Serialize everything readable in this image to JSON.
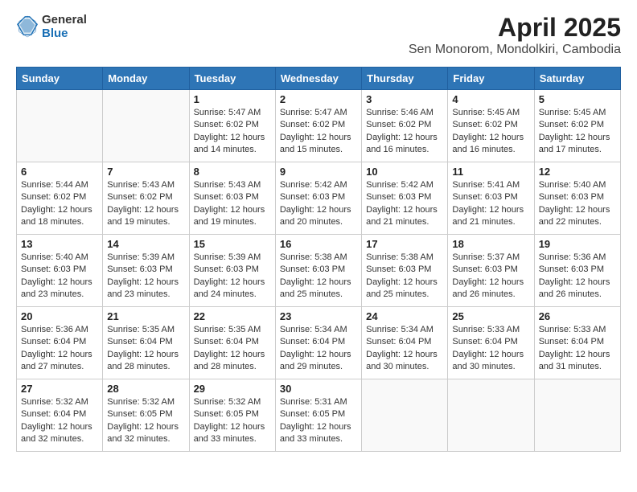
{
  "header": {
    "logo_general": "General",
    "logo_blue": "Blue",
    "month_title": "April 2025",
    "location": "Sen Monorom, Mondolkiri, Cambodia"
  },
  "days_of_week": [
    "Sunday",
    "Monday",
    "Tuesday",
    "Wednesday",
    "Thursday",
    "Friday",
    "Saturday"
  ],
  "weeks": [
    [
      {
        "day": "",
        "sunrise": "",
        "sunset": "",
        "daylight": ""
      },
      {
        "day": "",
        "sunrise": "",
        "sunset": "",
        "daylight": ""
      },
      {
        "day": "1",
        "sunrise": "Sunrise: 5:47 AM",
        "sunset": "Sunset: 6:02 PM",
        "daylight": "Daylight: 12 hours and 14 minutes."
      },
      {
        "day": "2",
        "sunrise": "Sunrise: 5:47 AM",
        "sunset": "Sunset: 6:02 PM",
        "daylight": "Daylight: 12 hours and 15 minutes."
      },
      {
        "day": "3",
        "sunrise": "Sunrise: 5:46 AM",
        "sunset": "Sunset: 6:02 PM",
        "daylight": "Daylight: 12 hours and 16 minutes."
      },
      {
        "day": "4",
        "sunrise": "Sunrise: 5:45 AM",
        "sunset": "Sunset: 6:02 PM",
        "daylight": "Daylight: 12 hours and 16 minutes."
      },
      {
        "day": "5",
        "sunrise": "Sunrise: 5:45 AM",
        "sunset": "Sunset: 6:02 PM",
        "daylight": "Daylight: 12 hours and 17 minutes."
      }
    ],
    [
      {
        "day": "6",
        "sunrise": "Sunrise: 5:44 AM",
        "sunset": "Sunset: 6:02 PM",
        "daylight": "Daylight: 12 hours and 18 minutes."
      },
      {
        "day": "7",
        "sunrise": "Sunrise: 5:43 AM",
        "sunset": "Sunset: 6:02 PM",
        "daylight": "Daylight: 12 hours and 19 minutes."
      },
      {
        "day": "8",
        "sunrise": "Sunrise: 5:43 AM",
        "sunset": "Sunset: 6:03 PM",
        "daylight": "Daylight: 12 hours and 19 minutes."
      },
      {
        "day": "9",
        "sunrise": "Sunrise: 5:42 AM",
        "sunset": "Sunset: 6:03 PM",
        "daylight": "Daylight: 12 hours and 20 minutes."
      },
      {
        "day": "10",
        "sunrise": "Sunrise: 5:42 AM",
        "sunset": "Sunset: 6:03 PM",
        "daylight": "Daylight: 12 hours and 21 minutes."
      },
      {
        "day": "11",
        "sunrise": "Sunrise: 5:41 AM",
        "sunset": "Sunset: 6:03 PM",
        "daylight": "Daylight: 12 hours and 21 minutes."
      },
      {
        "day": "12",
        "sunrise": "Sunrise: 5:40 AM",
        "sunset": "Sunset: 6:03 PM",
        "daylight": "Daylight: 12 hours and 22 minutes."
      }
    ],
    [
      {
        "day": "13",
        "sunrise": "Sunrise: 5:40 AM",
        "sunset": "Sunset: 6:03 PM",
        "daylight": "Daylight: 12 hours and 23 minutes."
      },
      {
        "day": "14",
        "sunrise": "Sunrise: 5:39 AM",
        "sunset": "Sunset: 6:03 PM",
        "daylight": "Daylight: 12 hours and 23 minutes."
      },
      {
        "day": "15",
        "sunrise": "Sunrise: 5:39 AM",
        "sunset": "Sunset: 6:03 PM",
        "daylight": "Daylight: 12 hours and 24 minutes."
      },
      {
        "day": "16",
        "sunrise": "Sunrise: 5:38 AM",
        "sunset": "Sunset: 6:03 PM",
        "daylight": "Daylight: 12 hours and 25 minutes."
      },
      {
        "day": "17",
        "sunrise": "Sunrise: 5:38 AM",
        "sunset": "Sunset: 6:03 PM",
        "daylight": "Daylight: 12 hours and 25 minutes."
      },
      {
        "day": "18",
        "sunrise": "Sunrise: 5:37 AM",
        "sunset": "Sunset: 6:03 PM",
        "daylight": "Daylight: 12 hours and 26 minutes."
      },
      {
        "day": "19",
        "sunrise": "Sunrise: 5:36 AM",
        "sunset": "Sunset: 6:03 PM",
        "daylight": "Daylight: 12 hours and 26 minutes."
      }
    ],
    [
      {
        "day": "20",
        "sunrise": "Sunrise: 5:36 AM",
        "sunset": "Sunset: 6:04 PM",
        "daylight": "Daylight: 12 hours and 27 minutes."
      },
      {
        "day": "21",
        "sunrise": "Sunrise: 5:35 AM",
        "sunset": "Sunset: 6:04 PM",
        "daylight": "Daylight: 12 hours and 28 minutes."
      },
      {
        "day": "22",
        "sunrise": "Sunrise: 5:35 AM",
        "sunset": "Sunset: 6:04 PM",
        "daylight": "Daylight: 12 hours and 28 minutes."
      },
      {
        "day": "23",
        "sunrise": "Sunrise: 5:34 AM",
        "sunset": "Sunset: 6:04 PM",
        "daylight": "Daylight: 12 hours and 29 minutes."
      },
      {
        "day": "24",
        "sunrise": "Sunrise: 5:34 AM",
        "sunset": "Sunset: 6:04 PM",
        "daylight": "Daylight: 12 hours and 30 minutes."
      },
      {
        "day": "25",
        "sunrise": "Sunrise: 5:33 AM",
        "sunset": "Sunset: 6:04 PM",
        "daylight": "Daylight: 12 hours and 30 minutes."
      },
      {
        "day": "26",
        "sunrise": "Sunrise: 5:33 AM",
        "sunset": "Sunset: 6:04 PM",
        "daylight": "Daylight: 12 hours and 31 minutes."
      }
    ],
    [
      {
        "day": "27",
        "sunrise": "Sunrise: 5:32 AM",
        "sunset": "Sunset: 6:04 PM",
        "daylight": "Daylight: 12 hours and 32 minutes."
      },
      {
        "day": "28",
        "sunrise": "Sunrise: 5:32 AM",
        "sunset": "Sunset: 6:05 PM",
        "daylight": "Daylight: 12 hours and 32 minutes."
      },
      {
        "day": "29",
        "sunrise": "Sunrise: 5:32 AM",
        "sunset": "Sunset: 6:05 PM",
        "daylight": "Daylight: 12 hours and 33 minutes."
      },
      {
        "day": "30",
        "sunrise": "Sunrise: 5:31 AM",
        "sunset": "Sunset: 6:05 PM",
        "daylight": "Daylight: 12 hours and 33 minutes."
      },
      {
        "day": "",
        "sunrise": "",
        "sunset": "",
        "daylight": ""
      },
      {
        "day": "",
        "sunrise": "",
        "sunset": "",
        "daylight": ""
      },
      {
        "day": "",
        "sunrise": "",
        "sunset": "",
        "daylight": ""
      }
    ]
  ]
}
